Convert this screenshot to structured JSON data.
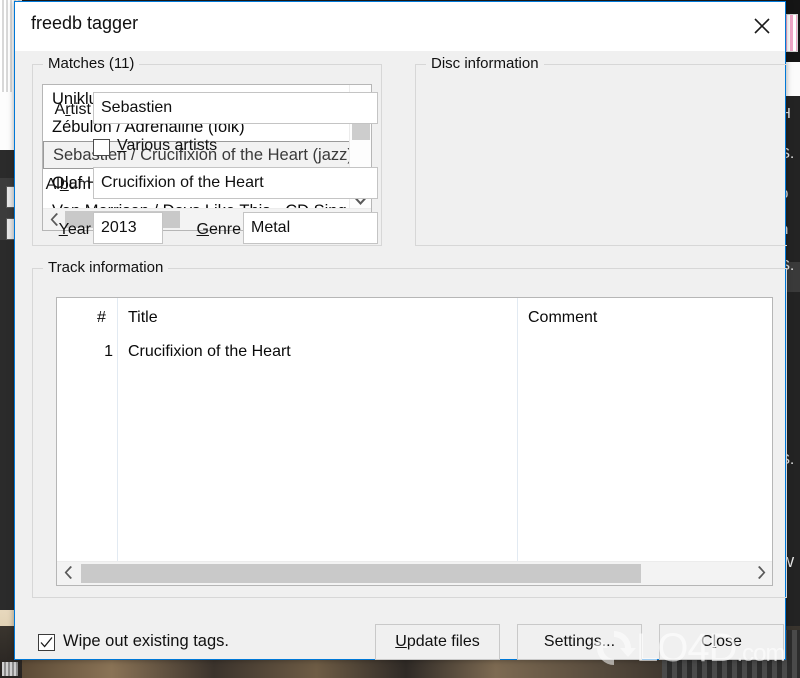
{
  "window": {
    "title": "freedb tagger",
    "close_icon": "close-x-icon",
    "accent_color": "#0078d7"
  },
  "matches": {
    "group_label": "Matches (11)",
    "count": 11,
    "items": [
      {
        "label": "Uniklubi / Huomenna (Promo) (data)",
        "selected": false
      },
      {
        "label": "Zébulon / Adrénaline (folk)",
        "selected": false
      },
      {
        "label": "Sebastien / Crucifixion of the Heart (jazz)",
        "selected": true
      },
      {
        "label": "Olaf Henning / Cowboy und Indianer (K",
        "selected": false
      },
      {
        "label": "Van Morrison / Days Like This - CD Sing",
        "selected": false
      }
    ],
    "scroll_up_icon": "chevron-up-icon",
    "scroll_down_icon": "chevron-down-icon",
    "scroll_left_icon": "chevron-left-icon",
    "scroll_right_icon": "chevron-right-icon"
  },
  "disc": {
    "group_label": "Disc information",
    "artist": {
      "label_prefix": "A",
      "label_accel": "r",
      "label_suffix": "tist",
      "value": "Sebastien"
    },
    "various": {
      "label_prefix": "",
      "label_accel": "V",
      "label_suffix": "arious artists",
      "checked": false
    },
    "album": {
      "label_prefix": "Al",
      "label_accel": "b",
      "label_suffix": "um",
      "value": "Crucifixion of the Heart"
    },
    "year": {
      "label_prefix": "",
      "label_accel": "Y",
      "label_suffix": "ear",
      "value": "2013"
    },
    "genre": {
      "label_prefix": "",
      "label_accel": "G",
      "label_suffix": "enre",
      "value": "Metal"
    }
  },
  "tracks": {
    "group_label": "Track information",
    "columns": [
      "#",
      "Title",
      "Comment"
    ],
    "rows": [
      {
        "num": "1",
        "title": "Crucifixion of the Heart",
        "comment": ""
      }
    ],
    "scroll_left_icon": "chevron-left-icon",
    "scroll_right_icon": "chevron-right-icon"
  },
  "footer": {
    "wipe": {
      "label": "Wipe out existing tags.",
      "checked": true
    },
    "update_button": {
      "prefix": "",
      "accel": "U",
      "suffix": "pdate files"
    },
    "settings_button": {
      "prefix": "Settings...",
      "accel": "",
      "suffix": ""
    },
    "close_button": {
      "prefix": "C",
      "accel": "l",
      "suffix": "ose"
    }
  },
  "watermark": {
    "text": "LO4D",
    "suffix": ".com",
    "logo_icon": "refresh-circle-icon"
  },
  "background": {
    "right_text_fragments": [
      "H",
      "S.",
      "b",
      "n",
      "S.",
      "S.",
      ". W"
    ]
  }
}
